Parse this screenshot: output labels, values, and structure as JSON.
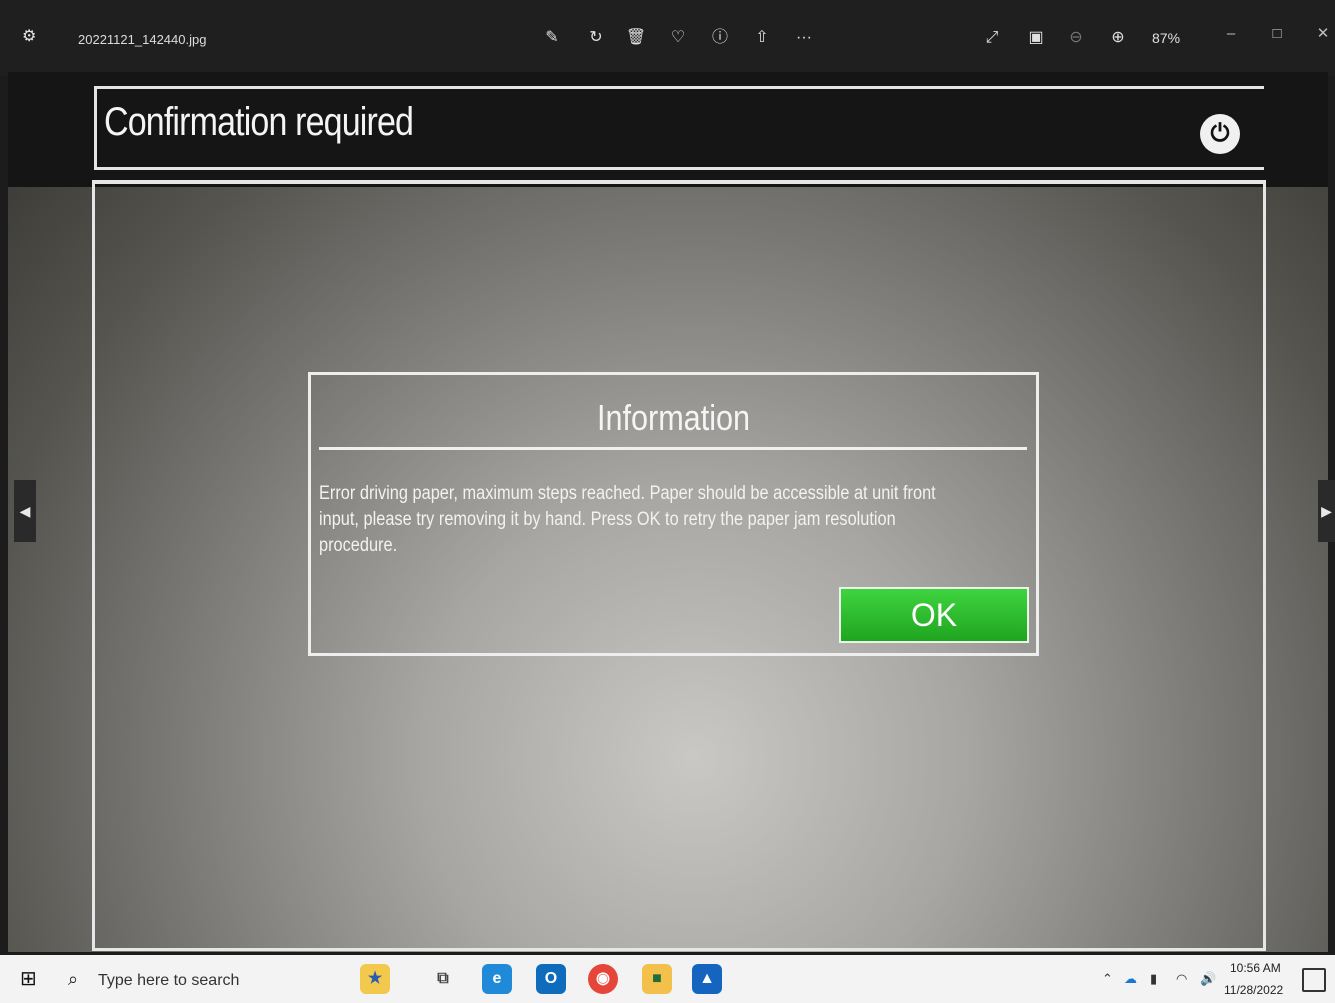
{
  "viewer": {
    "filename": "20221121_142440.jpg",
    "zoom": "87%",
    "toolbar_icons": [
      "edit-icon",
      "rotate-icon",
      "delete-icon",
      "heart-icon",
      "info-icon",
      "share-icon",
      "more-icon"
    ],
    "more_glyph": "···"
  },
  "photo": {
    "screen_title": "Confirmation required",
    "dialog": {
      "title": "Information",
      "message": "Error driving paper, maximum steps reached. Paper should be accessible at unit front input, please try removing it by hand. Press OK to retry the paper jam resolution procedure.",
      "ok_label": "OK"
    }
  },
  "taskbar": {
    "search_placeholder": "Type here to search",
    "time": "10:56 AM",
    "date": "11/28/2022"
  },
  "colors": {
    "ok_button": "#22b422",
    "titlebar": "#1f1f1f",
    "taskbar": "#f3f3f3"
  }
}
